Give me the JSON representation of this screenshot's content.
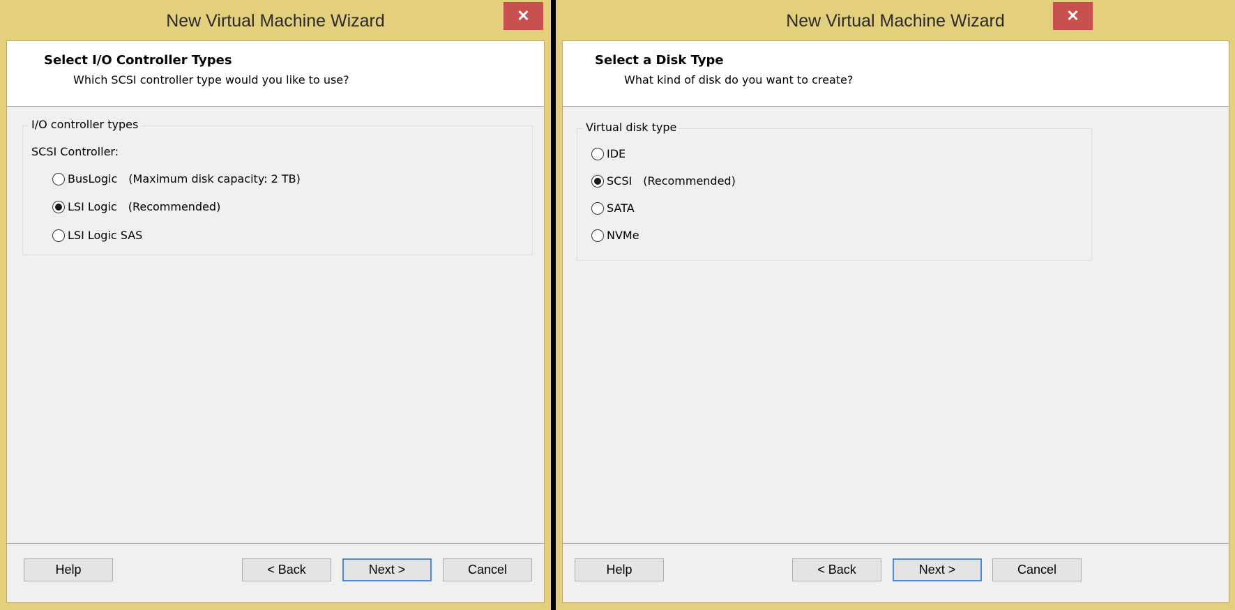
{
  "left_dialog": {
    "title": "New Virtual Machine Wizard",
    "close_glyph": "✕",
    "header_title": "Select I/O Controller Types",
    "header_subtitle": "Which SCSI controller type would you like to use?",
    "group_label": "I/O controller types",
    "section_label": "SCSI Controller:",
    "options": [
      {
        "label": "BusLogic",
        "note": "(Maximum disk capacity: 2 TB)",
        "selected": false
      },
      {
        "label": "LSI Logic",
        "note": "(Recommended)",
        "selected": true
      },
      {
        "label": "LSI Logic SAS",
        "note": "",
        "selected": false
      }
    ],
    "buttons": {
      "help": "Help",
      "back": "< Back",
      "next": "Next >",
      "cancel": "Cancel"
    }
  },
  "right_dialog": {
    "title": "New Virtual Machine Wizard",
    "close_glyph": "✕",
    "header_title": "Select a Disk Type",
    "header_subtitle": "What kind of disk do you want to create?",
    "group_label": "Virtual disk type",
    "options": [
      {
        "label": "IDE",
        "note": "",
        "selected": false
      },
      {
        "label": "SCSI",
        "note": "(Recommended)",
        "selected": true
      },
      {
        "label": "SATA",
        "note": "",
        "selected": false
      },
      {
        "label": "NVMe",
        "note": "",
        "selected": false
      }
    ],
    "buttons": {
      "help": "Help",
      "back": "< Back",
      "next": "Next >",
      "cancel": "Cancel"
    }
  },
  "colors": {
    "frame": "#e3cf7c",
    "close": "#c75050",
    "default_button_border": "#4a8ad8"
  }
}
